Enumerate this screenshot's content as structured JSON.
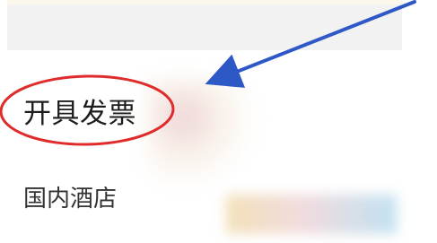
{
  "screen": {
    "invoice_label": "开具发票",
    "hotel_label": "国内酒店"
  },
  "annotations": {
    "circle_color": "#e02b2b",
    "arrow_color": "#2f58c7"
  }
}
